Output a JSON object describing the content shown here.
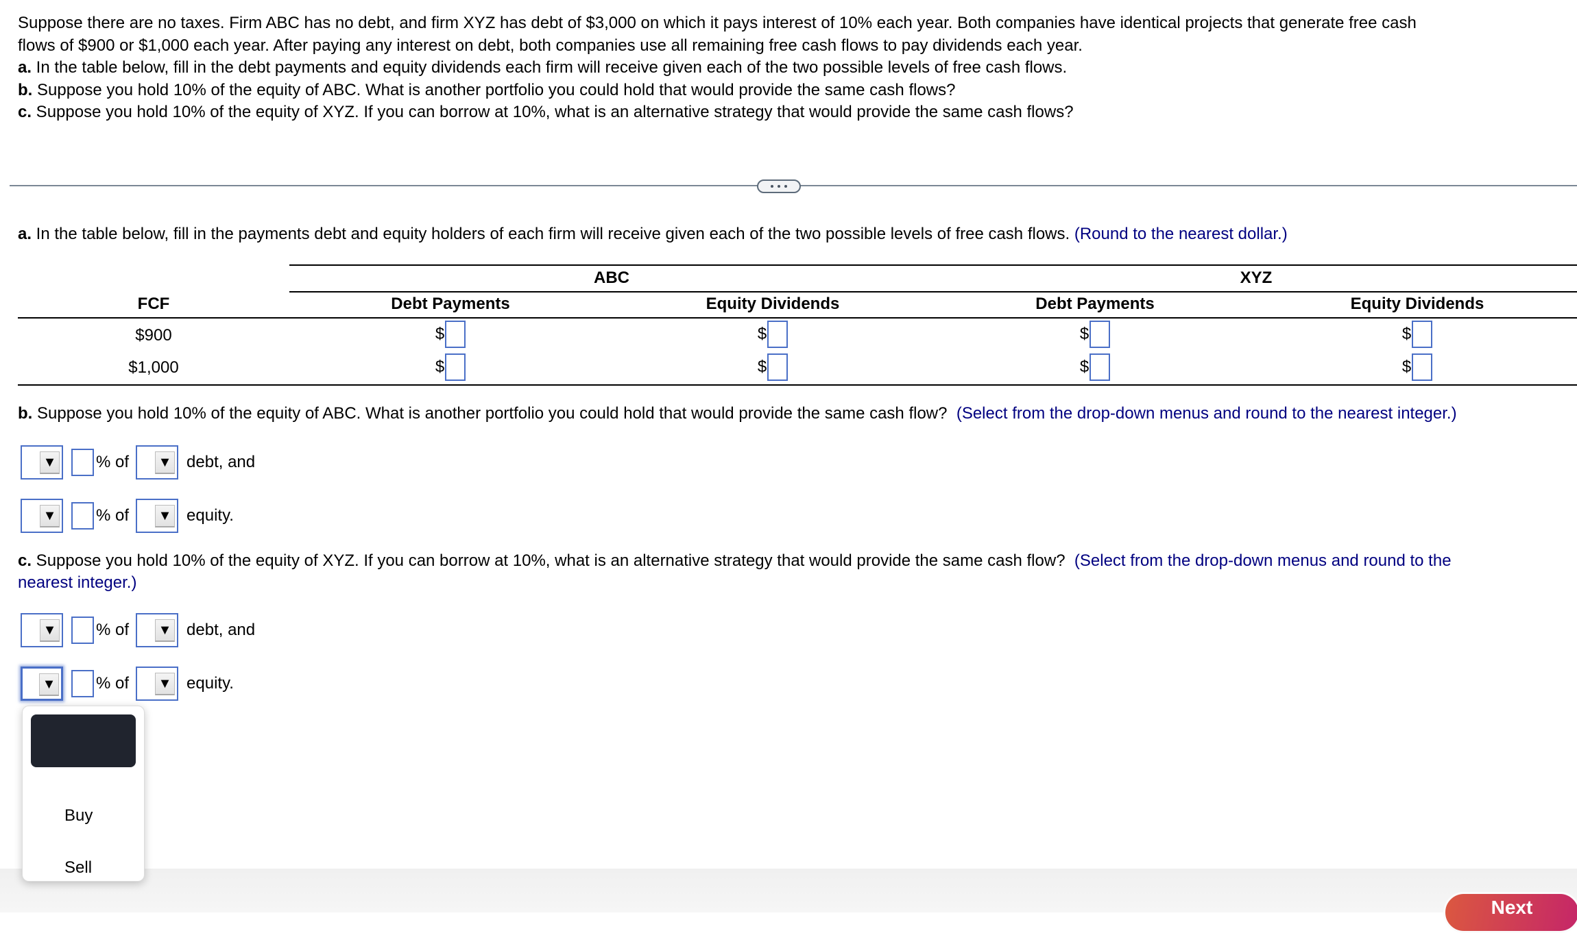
{
  "intro": {
    "line1": "Suppose there are no taxes. Firm ABC has no debt, and firm XYZ has debt of $3,000 on which it pays interest of 10% each year. Both companies have identical projects that generate free cash",
    "line2": "flows of $900 or $1,000 each year. After paying any interest on debt, both companies use all remaining free cash flows to pay dividends each year.",
    "a_label": "a.",
    "a_text": " In the table below, fill in the debt payments and equity dividends each firm will receive given each of the two possible levels of free cash flows.",
    "b_label": "b.",
    "b_text": " Suppose you hold 10% of the equity of ABC. What is another portfolio you could hold that would provide the same cash flows?",
    "c_label": "c.",
    "c_text": " Suppose you hold 10% of the equity of XYZ. If you can borrow at 10%, what is an alternative strategy that would provide the same cash flows?"
  },
  "part_a": {
    "label": "a.",
    "text": " In the table below, fill in the payments debt and equity holders of each firm will receive given each of the two possible levels of free cash flows.",
    "hint": "(Round to the nearest dollar.)",
    "table": {
      "group_headers": [
        "ABC",
        "XYZ"
      ],
      "col_headers": [
        "FCF",
        "Debt Payments",
        "Equity Dividends",
        "Debt Payments",
        "Equity Dividends"
      ],
      "currency_symbol": "$",
      "rows": [
        {
          "fcf": "$900",
          "abc_debt": "",
          "abc_equity": "",
          "xyz_debt": "",
          "xyz_equity": ""
        },
        {
          "fcf": "$1,000",
          "abc_debt": "",
          "abc_equity": "",
          "xyz_debt": "",
          "xyz_equity": ""
        }
      ]
    }
  },
  "part_b": {
    "label": "b.",
    "text": " Suppose you hold 10% of the equity of ABC. What is another portfolio you could hold that would provide the same cash flow?",
    "hint": "(Select from the drop-down menus and round to the nearest integer.)",
    "rows": [
      {
        "action": "",
        "percent": "",
        "pct_label": "% of",
        "firm": "",
        "tail": "debt, and"
      },
      {
        "action": "",
        "percent": "",
        "pct_label": "% of",
        "firm": "",
        "tail": "equity."
      }
    ]
  },
  "part_c": {
    "label": "c.",
    "text": " Suppose you hold 10% of the equity of XYZ. If you can borrow at 10%, what is an alternative strategy that would provide the same cash flow?",
    "hint_line1": "(Select from the drop-down menus and round to the",
    "hint_line2": "nearest integer.)",
    "rows": [
      {
        "action": "",
        "percent": "",
        "pct_label": "% of",
        "firm": "",
        "tail": "debt, and"
      },
      {
        "action": "",
        "percent": "",
        "pct_label": "% of",
        "firm": "",
        "tail": "equity."
      }
    ]
  },
  "dropdown_popup": {
    "options": [
      "",
      "Buy",
      "Sell"
    ],
    "highlighted_index": 0
  },
  "footer": {
    "next_label": "Next"
  },
  "icons": {
    "dropdown_arrow": "▼"
  }
}
